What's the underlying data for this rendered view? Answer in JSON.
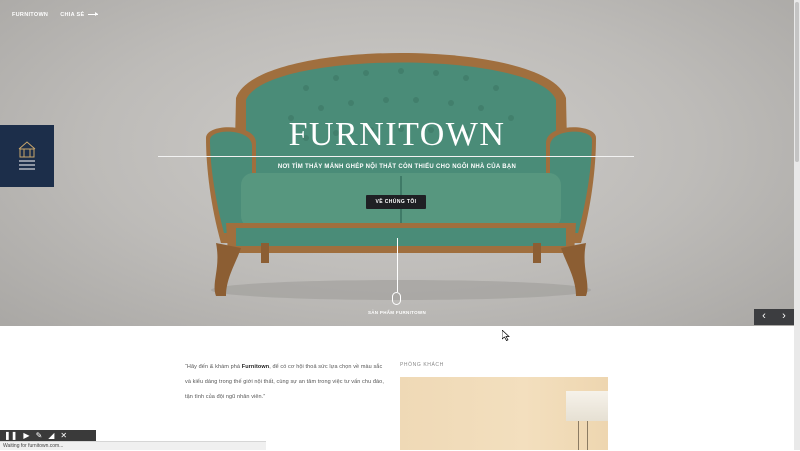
{
  "nav": {
    "brand": "FURNITOWN",
    "share": "CHIA SẺ"
  },
  "hero": {
    "title": "FURNITOWN",
    "subtitle": "NƠI TÌM THẤY MẢNH GHÉP NỘI THẤT CÒN THIẾU CHO NGÔI NHÀ CỦA BẠN",
    "about_button": "VỀ CHÚNG TÔI",
    "products_link": "SẢN PHẨM FURNITOWN"
  },
  "slider": {
    "prev": "‹",
    "next": "›"
  },
  "intro": {
    "quote_open": "“Hãy đến & khám phá ",
    "quote_brand": "Furnitown",
    "quote_rest": ", để có cơ hội thoả sức lựa chọn về màu sắc và kiểu dáng trong thế giới nội thất, cùng sự an tâm trong việc tư vấn chu đáo, tận tình của đội ngũ nhân viên.”"
  },
  "section": {
    "phong_khach": "PHÒNG KHÁCH"
  },
  "status": {
    "text": "Waiting for furnitown.com..."
  },
  "colors": {
    "menu_bg": "#1c2e4a",
    "sofa": "#4a8c78",
    "wood": "#9a6b3f"
  }
}
